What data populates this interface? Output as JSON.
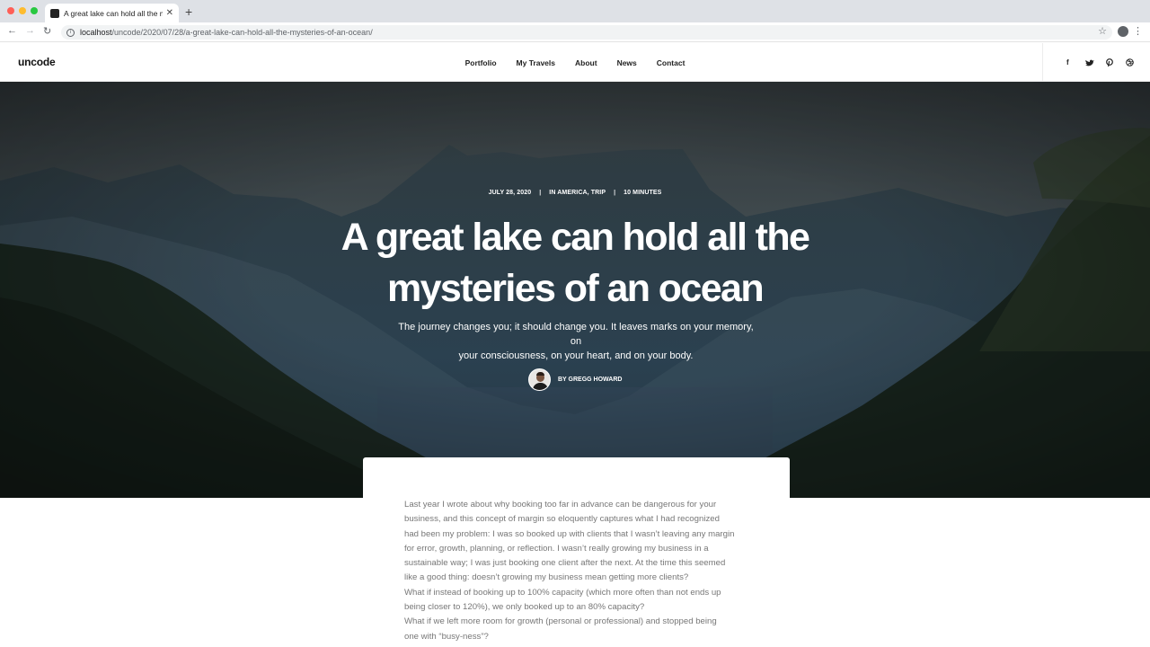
{
  "browser": {
    "tab_title": "A great lake can hold all the m",
    "new_tab_label": "+",
    "url_host": "localhost",
    "url_path": "/uncode/2020/07/28/a-great-lake-can-hold-all-the-mysteries-of-an-ocean/",
    "icons": [
      "back-icon",
      "forward-icon",
      "reload-icon",
      "info-icon",
      "star-icon",
      "account-icon",
      "menu-icon"
    ]
  },
  "header": {
    "logo": "uncode",
    "nav": [
      {
        "label": "Portfolio"
      },
      {
        "label": "My Travels"
      },
      {
        "label": "About"
      },
      {
        "label": "News"
      },
      {
        "label": "Contact"
      }
    ],
    "social_icons": [
      "facebook-icon",
      "twitter-icon",
      "pinterest-icon",
      "dribbble-icon"
    ]
  },
  "hero": {
    "date": "JULY 28, 2020",
    "categories": "IN AMERICA, TRIP",
    "read_time": "10 MINUTES",
    "title_line1": "A great lake can hold all the",
    "title_line2": "mysteries of an ocean",
    "subtitle_line1": "The journey changes you; it should change you. It leaves marks on your memory, on",
    "subtitle_line2": "your consciousness, on your heart, and on your body.",
    "author": "BY GREGG HOWARD"
  },
  "article": {
    "lines": [
      "Last year I wrote about why booking too far in advance can be dangerous for your",
      "business, and this concept of margin so eloquently captures what I had recognized",
      "had been my problem: I was so booked up with clients that I wasn’t leaving any margin",
      "for error, growth, planning, or reflection. I wasn’t really growing my business in a",
      "sustainable way; I was just booking one client after the next. At the time this seemed",
      "like a good thing: doesn’t growing my business mean getting more clients?",
      "What if instead of booking up to 100% capacity (which more often than not ends up",
      "being closer to 120%), we only booked up to an 80% capacity?",
      "What if we left more room for growth (personal or professional) and stopped being",
      "one with “busy-ness”?"
    ]
  }
}
